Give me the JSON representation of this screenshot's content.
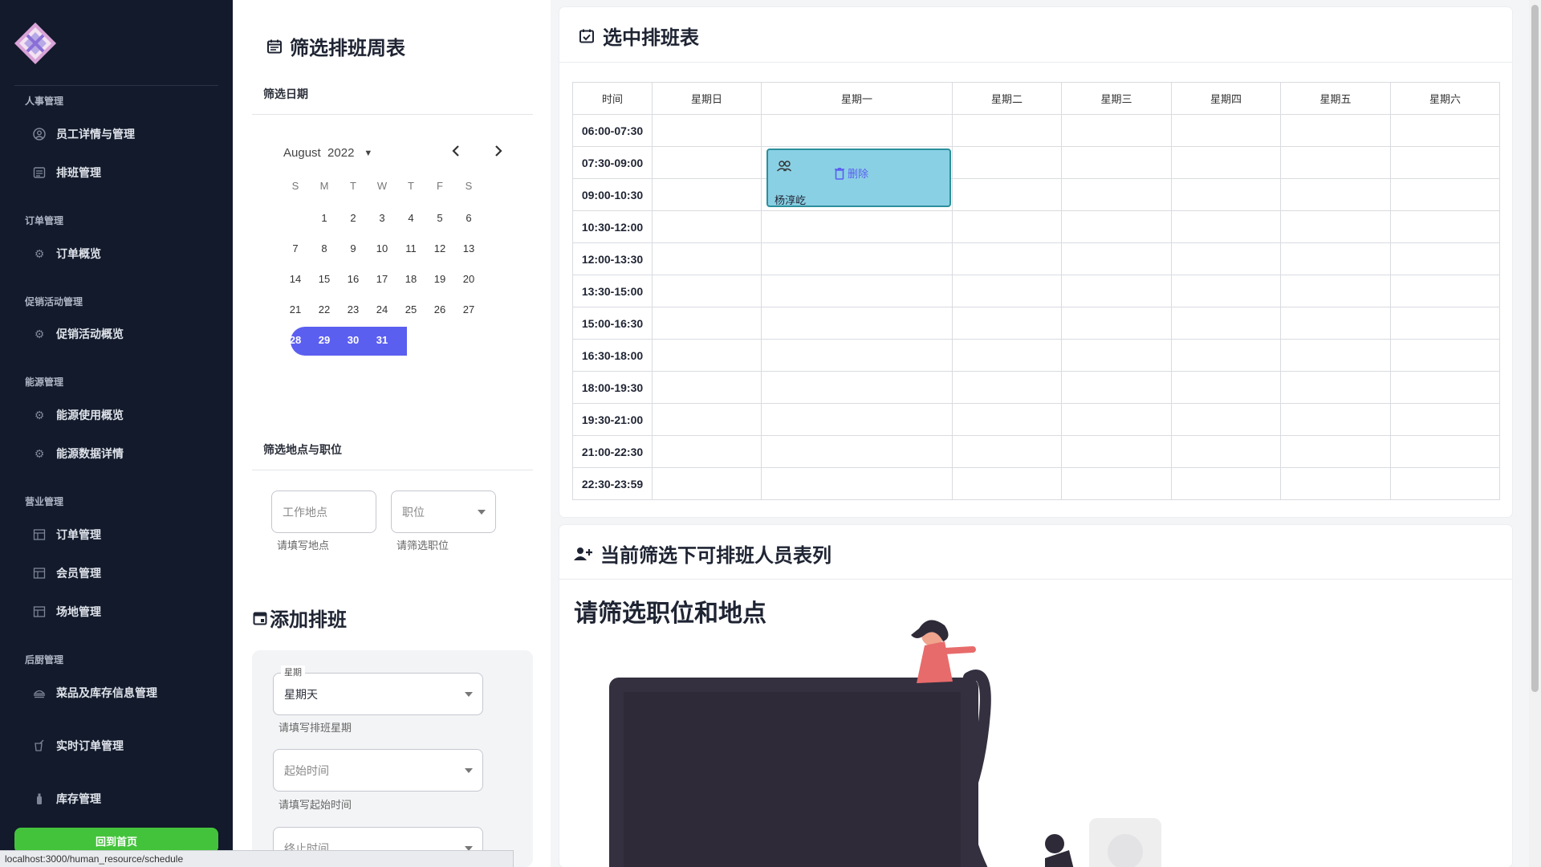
{
  "sidebar": {
    "groups": [
      {
        "title": "人事管理",
        "items": [
          {
            "label": "员工详情与管理",
            "icon": "person-circle-icon"
          },
          {
            "label": "排班管理",
            "icon": "schedule-list-icon"
          }
        ]
      },
      {
        "title": "订单管理",
        "items": [
          {
            "label": "订单概览",
            "icon": "gear-icon"
          }
        ]
      },
      {
        "title": "促销活动管理",
        "items": [
          {
            "label": "促销活动概览",
            "icon": "gear-icon"
          }
        ]
      },
      {
        "title": "能源管理",
        "items": [
          {
            "label": "能源使用概览",
            "icon": "gear-icon"
          },
          {
            "label": "能源数据详情",
            "icon": "gear-icon"
          }
        ]
      },
      {
        "title": "营业管理",
        "items": [
          {
            "label": "订单管理",
            "icon": "table-icon"
          },
          {
            "label": "会员管理",
            "icon": "table-icon"
          },
          {
            "label": "场地管理",
            "icon": "table-icon"
          }
        ]
      },
      {
        "title": "后厨管理",
        "items": [
          {
            "label": "菜品及库存信息管理",
            "icon": "food-icon"
          },
          {
            "label": "实时订单管理",
            "icon": "drink-icon"
          },
          {
            "label": "库存管理",
            "icon": "bottle-icon"
          }
        ]
      }
    ],
    "home_button": "回到首页"
  },
  "status_url": "localhost:3000/human_resource/schedule",
  "filter": {
    "title": "筛选排班周表",
    "date_section": "筛选日期",
    "calendar": {
      "month": "August",
      "year": "2022",
      "weekdays": [
        "S",
        "M",
        "T",
        "W",
        "T",
        "F",
        "S"
      ],
      "first_weekday": 1,
      "days_in_month": 31,
      "selected_days": [
        28,
        29,
        30,
        31
      ]
    },
    "location_section": "筛选地点与职位",
    "location_placeholder": "工作地点",
    "location_helper": "请填写地点",
    "position_placeholder": "职位",
    "position_helper": "请筛选职位"
  },
  "add": {
    "title": "添加排班",
    "weekday_label": "星期",
    "weekday_value": "星期天",
    "weekday_helper": "请填写排班星期",
    "start_placeholder": "起始时间",
    "start_helper": "请填写起始时间",
    "end_placeholder": "终止时间"
  },
  "schedule": {
    "title": "选中排班表",
    "columns": [
      "时间",
      "星期日",
      "星期一",
      "星期二",
      "星期三",
      "星期四",
      "星期五",
      "星期六"
    ],
    "times": [
      "06:00-07:30",
      "07:30-09:00",
      "09:00-10:30",
      "10:30-12:00",
      "12:00-13:30",
      "13:30-15:00",
      "15:00-16:30",
      "16:30-18:00",
      "18:00-19:30",
      "19:30-21:00",
      "21:00-22:30",
      "22:30-23:59"
    ],
    "event": {
      "delete_label": "删除",
      "name": "杨淳屹"
    }
  },
  "staff": {
    "title": "当前筛选下可排班人员表列",
    "prompt": "请筛选职位和地点"
  }
}
